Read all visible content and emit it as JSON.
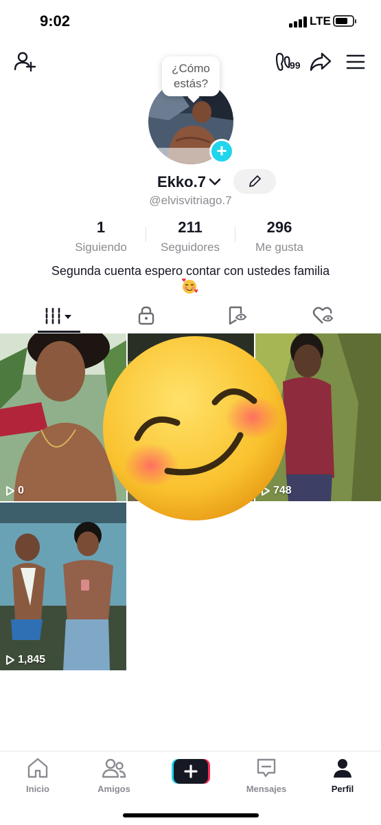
{
  "status_bar": {
    "time": "9:02",
    "network": "LTE",
    "battery_level": 0.75
  },
  "header": {
    "add_friend_icon": "person-plus-icon",
    "icons": [
      "footprint-icon",
      "share-icon",
      "menu-icon"
    ],
    "footprint_count": "99"
  },
  "profile": {
    "bubble_line1": "¿Cómo",
    "bubble_line2": "estás?",
    "display_name": "Ekko.7",
    "handle": "@elvisvitriago.7",
    "bio": "Segunda cuenta espero contar con ustedes familia",
    "bio_emoji": "smiling-face-with-hearts"
  },
  "stats": [
    {
      "value": "1",
      "label": "Siguiendo"
    },
    {
      "value": "211",
      "label": "Seguidores"
    },
    {
      "value": "296",
      "label": "Me gusta"
    }
  ],
  "tabs": [
    "videos-grid-icon",
    "lock-icon",
    "repost-icon",
    "liked-icon"
  ],
  "videos": [
    {
      "views": "0"
    },
    {
      "views": ""
    },
    {
      "views": "748"
    },
    {
      "views": "1,845"
    }
  ],
  "nav": [
    {
      "label": "Inicio"
    },
    {
      "label": "Amigos"
    },
    {
      "label": ""
    },
    {
      "label": "Mensajes"
    },
    {
      "label": "Perfil"
    }
  ],
  "colors": {
    "accent_cyan": "#20d5ec",
    "accent_red": "#fe2c55",
    "text_primary": "#161823",
    "text_secondary": "#8a8b91"
  }
}
